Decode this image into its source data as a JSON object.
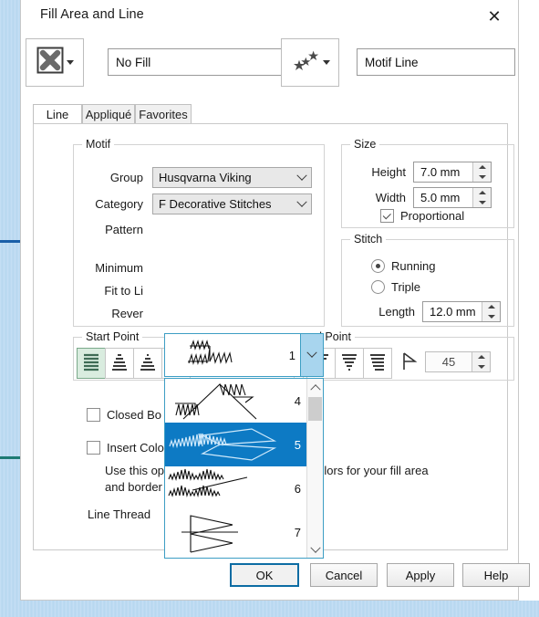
{
  "window": {
    "title": "Fill Area and Line",
    "close_icon": "close-icon"
  },
  "top_row": {
    "fill_icon": "no-fill-x-icon",
    "fill_name": "No Fill",
    "line_icon": "motif-stars-icon",
    "line_name": "Motif Line"
  },
  "tabs": [
    {
      "label": "Line",
      "active": true
    },
    {
      "label": "Appliqué",
      "active": false
    },
    {
      "label": "Favorites",
      "active": false
    }
  ],
  "motif": {
    "title": "Motif",
    "group_label": "Group",
    "group_value": "Husqvarna Viking",
    "category_label": "Category",
    "category_value": "F Decorative Stitches",
    "pattern_label": "Pattern",
    "pattern_value": "1",
    "minimum_label": "Minimum",
    "fit_to_line_label": "Fit to Li",
    "reverse_label": "Rever"
  },
  "pattern_list": {
    "items": [
      {
        "num": "4",
        "selected": false
      },
      {
        "num": "5",
        "selected": true
      },
      {
        "num": "6",
        "selected": false
      },
      {
        "num": "7",
        "selected": false
      }
    ],
    "scroll_up_icon": "chevron-up-icon",
    "scroll_down_icon": "chevron-down-icon"
  },
  "size": {
    "title": "Size",
    "height_label": "Height",
    "height_value": "7.0 mm",
    "width_label": "Width",
    "width_value": "5.0 mm",
    "proportional_label": "Proportional",
    "proportional_checked": true
  },
  "stitch": {
    "title": "Stitch",
    "running_label": "Running",
    "running_selected": true,
    "triple_label": "Triple",
    "triple_selected": false,
    "length_label": "Length",
    "length_value": "12.0 mm"
  },
  "start_point": {
    "title": "Start Point",
    "buttons": [
      "start-point-mode-1",
      "start-point-mode-2",
      "start-point-mode-3",
      "start-point-mode-4"
    ],
    "selected_index": 0
  },
  "end_point": {
    "title": "d Point",
    "full_title": "End Point",
    "buttons": [
      "end-point-mode-1",
      "end-point-mode-2",
      "end-point-mode-3"
    ],
    "angle_icon": "angle-icon",
    "angle_value": "45"
  },
  "options": {
    "closed_border_label": "Closed Bo",
    "closed_border_full": "Closed Border",
    "closed_border_checked": false,
    "insert_color_change_label": "Insert Color Change",
    "insert_color_change_checked": false,
    "info_text": "Use this option to have different thread colors for your fill area and border line.",
    "line_thread_label": "Line Thread",
    "thread_color": "#bcd0e8",
    "palette_icon": "thread-palette-icon"
  },
  "footer": {
    "ok": "OK",
    "cancel": "Cancel",
    "apply": "Apply",
    "help": "Help"
  },
  "colors": {
    "accent_blue": "#0d7ac4",
    "default_button_border": "#0c6ca3",
    "selected_icon_bg": "#d9ecdf"
  }
}
